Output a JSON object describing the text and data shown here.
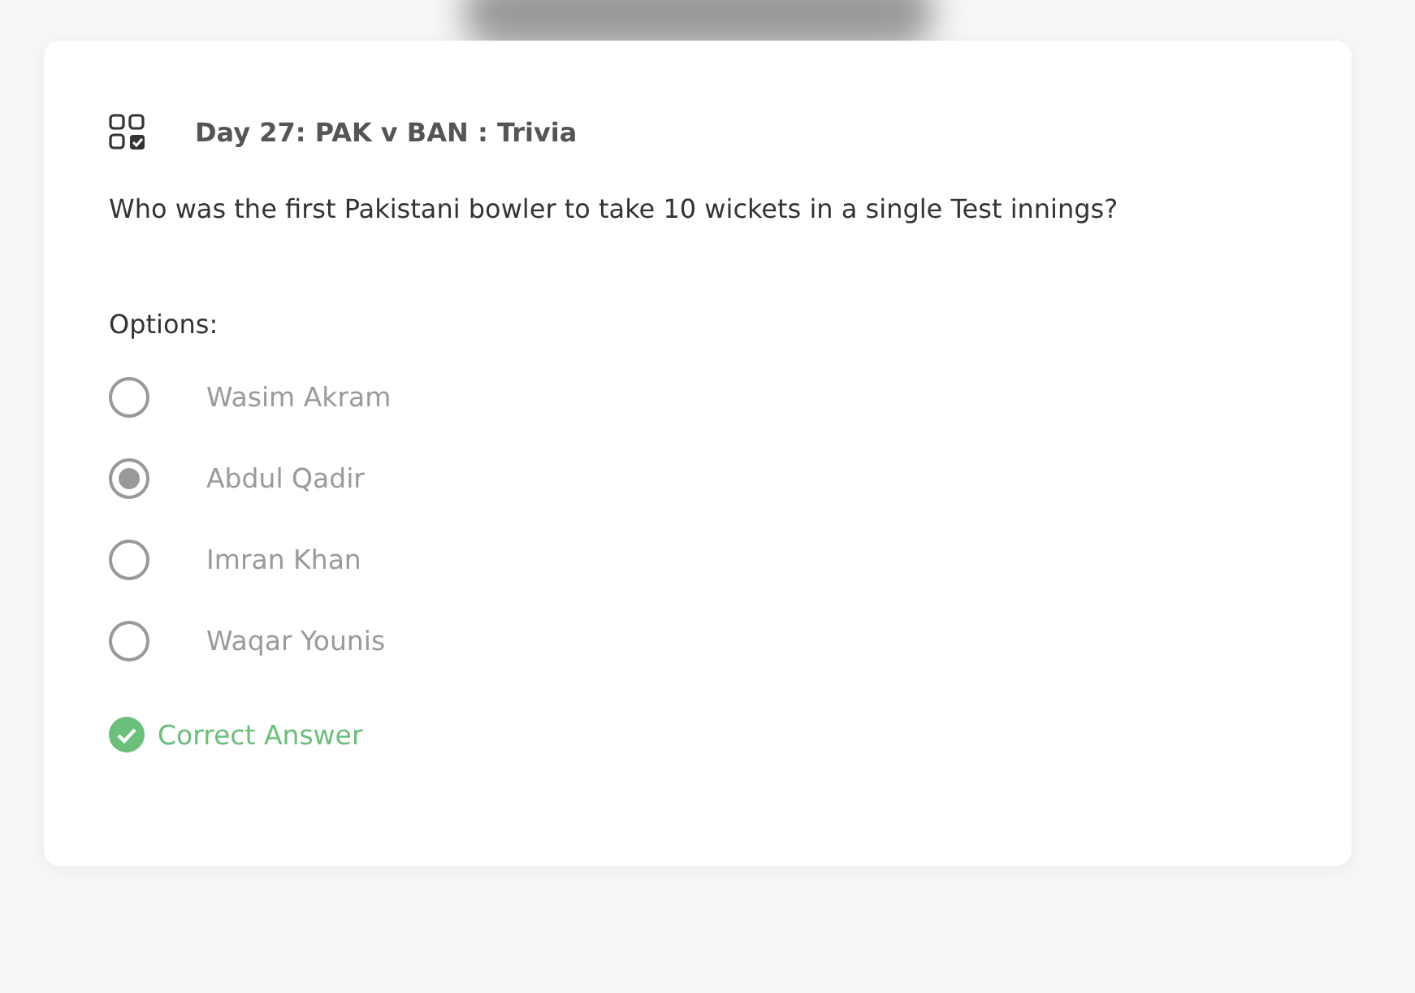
{
  "title": "Day 27: PAK v BAN : Trivia",
  "question": "Who was the first Pakistani bowler to take 10 wickets in a single Test innings?",
  "options_label": "Options:",
  "options": [
    {
      "label": "Wasim Akram",
      "selected": false
    },
    {
      "label": "Abdul Qadir",
      "selected": true
    },
    {
      "label": "Imran Khan",
      "selected": false
    },
    {
      "label": "Waqar Younis",
      "selected": false
    }
  ],
  "result": {
    "text": "Correct Answer",
    "correct": true
  }
}
